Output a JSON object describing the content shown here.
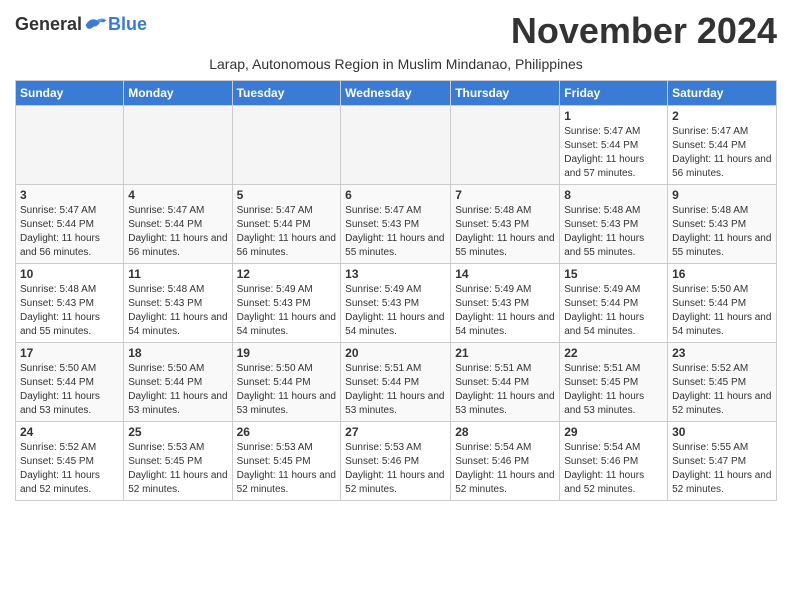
{
  "logo": {
    "general": "General",
    "blue": "Blue"
  },
  "header": {
    "month": "November 2024",
    "subtitle": "Larap, Autonomous Region in Muslim Mindanao, Philippines"
  },
  "weekdays": [
    "Sunday",
    "Monday",
    "Tuesday",
    "Wednesday",
    "Thursday",
    "Friday",
    "Saturday"
  ],
  "weeks": [
    [
      {
        "day": "",
        "info": ""
      },
      {
        "day": "",
        "info": ""
      },
      {
        "day": "",
        "info": ""
      },
      {
        "day": "",
        "info": ""
      },
      {
        "day": "",
        "info": ""
      },
      {
        "day": "1",
        "info": "Sunrise: 5:47 AM\nSunset: 5:44 PM\nDaylight: 11 hours and 57 minutes."
      },
      {
        "day": "2",
        "info": "Sunrise: 5:47 AM\nSunset: 5:44 PM\nDaylight: 11 hours and 56 minutes."
      }
    ],
    [
      {
        "day": "3",
        "info": "Sunrise: 5:47 AM\nSunset: 5:44 PM\nDaylight: 11 hours and 56 minutes."
      },
      {
        "day": "4",
        "info": "Sunrise: 5:47 AM\nSunset: 5:44 PM\nDaylight: 11 hours and 56 minutes."
      },
      {
        "day": "5",
        "info": "Sunrise: 5:47 AM\nSunset: 5:44 PM\nDaylight: 11 hours and 56 minutes."
      },
      {
        "day": "6",
        "info": "Sunrise: 5:47 AM\nSunset: 5:43 PM\nDaylight: 11 hours and 55 minutes."
      },
      {
        "day": "7",
        "info": "Sunrise: 5:48 AM\nSunset: 5:43 PM\nDaylight: 11 hours and 55 minutes."
      },
      {
        "day": "8",
        "info": "Sunrise: 5:48 AM\nSunset: 5:43 PM\nDaylight: 11 hours and 55 minutes."
      },
      {
        "day": "9",
        "info": "Sunrise: 5:48 AM\nSunset: 5:43 PM\nDaylight: 11 hours and 55 minutes."
      }
    ],
    [
      {
        "day": "10",
        "info": "Sunrise: 5:48 AM\nSunset: 5:43 PM\nDaylight: 11 hours and 55 minutes."
      },
      {
        "day": "11",
        "info": "Sunrise: 5:48 AM\nSunset: 5:43 PM\nDaylight: 11 hours and 54 minutes."
      },
      {
        "day": "12",
        "info": "Sunrise: 5:49 AM\nSunset: 5:43 PM\nDaylight: 11 hours and 54 minutes."
      },
      {
        "day": "13",
        "info": "Sunrise: 5:49 AM\nSunset: 5:43 PM\nDaylight: 11 hours and 54 minutes."
      },
      {
        "day": "14",
        "info": "Sunrise: 5:49 AM\nSunset: 5:43 PM\nDaylight: 11 hours and 54 minutes."
      },
      {
        "day": "15",
        "info": "Sunrise: 5:49 AM\nSunset: 5:44 PM\nDaylight: 11 hours and 54 minutes."
      },
      {
        "day": "16",
        "info": "Sunrise: 5:50 AM\nSunset: 5:44 PM\nDaylight: 11 hours and 54 minutes."
      }
    ],
    [
      {
        "day": "17",
        "info": "Sunrise: 5:50 AM\nSunset: 5:44 PM\nDaylight: 11 hours and 53 minutes."
      },
      {
        "day": "18",
        "info": "Sunrise: 5:50 AM\nSunset: 5:44 PM\nDaylight: 11 hours and 53 minutes."
      },
      {
        "day": "19",
        "info": "Sunrise: 5:50 AM\nSunset: 5:44 PM\nDaylight: 11 hours and 53 minutes."
      },
      {
        "day": "20",
        "info": "Sunrise: 5:51 AM\nSunset: 5:44 PM\nDaylight: 11 hours and 53 minutes."
      },
      {
        "day": "21",
        "info": "Sunrise: 5:51 AM\nSunset: 5:44 PM\nDaylight: 11 hours and 53 minutes."
      },
      {
        "day": "22",
        "info": "Sunrise: 5:51 AM\nSunset: 5:45 PM\nDaylight: 11 hours and 53 minutes."
      },
      {
        "day": "23",
        "info": "Sunrise: 5:52 AM\nSunset: 5:45 PM\nDaylight: 11 hours and 52 minutes."
      }
    ],
    [
      {
        "day": "24",
        "info": "Sunrise: 5:52 AM\nSunset: 5:45 PM\nDaylight: 11 hours and 52 minutes."
      },
      {
        "day": "25",
        "info": "Sunrise: 5:53 AM\nSunset: 5:45 PM\nDaylight: 11 hours and 52 minutes."
      },
      {
        "day": "26",
        "info": "Sunrise: 5:53 AM\nSunset: 5:45 PM\nDaylight: 11 hours and 52 minutes."
      },
      {
        "day": "27",
        "info": "Sunrise: 5:53 AM\nSunset: 5:46 PM\nDaylight: 11 hours and 52 minutes."
      },
      {
        "day": "28",
        "info": "Sunrise: 5:54 AM\nSunset: 5:46 PM\nDaylight: 11 hours and 52 minutes."
      },
      {
        "day": "29",
        "info": "Sunrise: 5:54 AM\nSunset: 5:46 PM\nDaylight: 11 hours and 52 minutes."
      },
      {
        "day": "30",
        "info": "Sunrise: 5:55 AM\nSunset: 5:47 PM\nDaylight: 11 hours and 52 minutes."
      }
    ]
  ]
}
